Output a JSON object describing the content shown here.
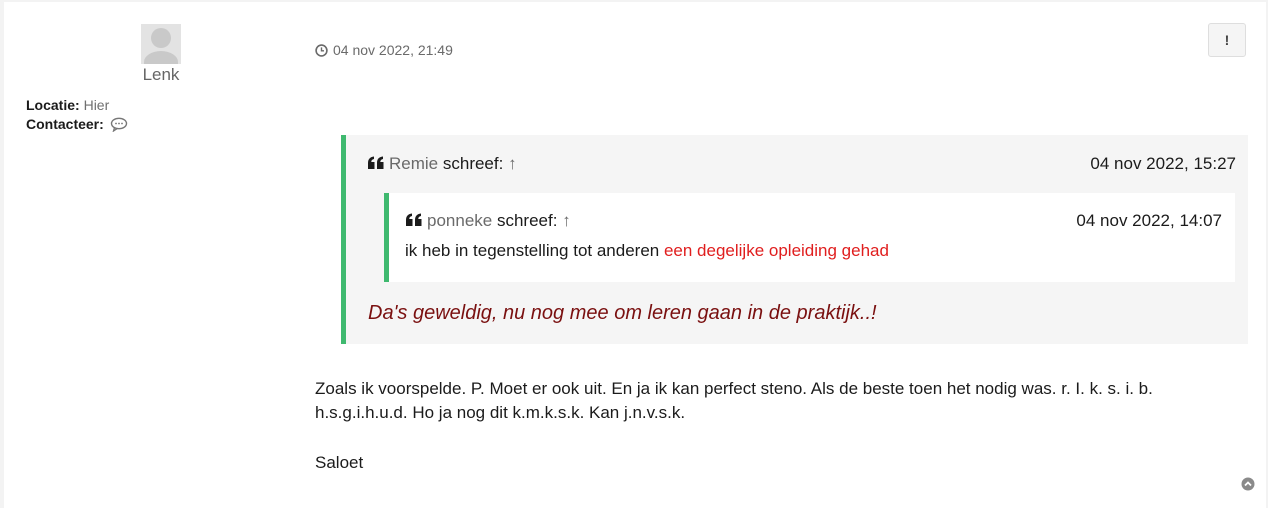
{
  "profile": {
    "username": "Lenk",
    "location_label": "Locatie:",
    "location_value": "Hier",
    "contact_label": "Contacteer:"
  },
  "post": {
    "date": "04 nov 2022, 21:49",
    "report_label": "!"
  },
  "quote": {
    "author": "Remie",
    "wrote": "schreef:",
    "arrow": "↑",
    "time": "04 nov 2022, 15:27",
    "reply": "Da's geweldig, nu nog mee om leren gaan in de praktijk..!",
    "nested": {
      "author": "ponneke",
      "wrote": "schreef:",
      "arrow": "↑",
      "time": "04 nov 2022, 14:07",
      "text_plain": "ik heb in tegenstelling tot anderen ",
      "text_highlight": "een degelijke opleiding gehad"
    }
  },
  "body": {
    "paragraph": "Zoals ik voorspelde. P. Moet er ook uit. En ja ik kan perfect steno. Als de beste toen het nodig was. r. I. k. s. i. b. h.s.g.i.h.u.d. Ho ja nog dit k.m.k.s.k. Kan j.n.v.s.k.",
    "signoff": "Saloet"
  },
  "colors": {
    "quote_border": "#3fb96f",
    "highlight": "#e01e1e",
    "reply_text": "#7a1010"
  },
  "icons": [
    "avatar-placeholder",
    "chat-icon",
    "clock-icon",
    "quote-icon",
    "scroll-top-icon"
  ]
}
